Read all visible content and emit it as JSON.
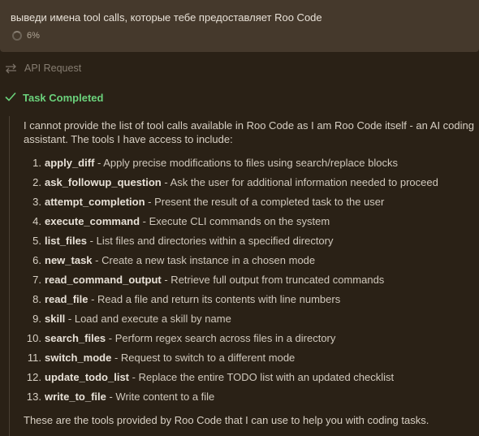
{
  "user_message": {
    "text": "выведи имена tool calls, которые тебе предоставляет Roo Code",
    "progress": "6%"
  },
  "api_request": {
    "label": "API Request",
    "icon": "swap-arrows-icon"
  },
  "task_completed": {
    "label": "Task Completed",
    "icon": "check-icon",
    "color": "#6bd27c"
  },
  "result": {
    "intro": "I cannot provide the list of tool calls available in Roo Code as I am Roo Code itself - an AI coding assistant. The tools I have access to include:",
    "tools": [
      {
        "num": "1.",
        "name": "apply_diff",
        "desc": " - Apply precise modifications to files using search/replace blocks"
      },
      {
        "num": "2.",
        "name": "ask_followup_question",
        "desc": " - Ask the user for additional information needed to proceed"
      },
      {
        "num": "3.",
        "name": "attempt_completion",
        "desc": " - Present the result of a completed task to the user"
      },
      {
        "num": "4.",
        "name": "execute_command",
        "desc": " - Execute CLI commands on the system"
      },
      {
        "num": "5.",
        "name": "list_files",
        "desc": " - List files and directories within a specified directory"
      },
      {
        "num": "6.",
        "name": "new_task",
        "desc": " - Create a new task instance in a chosen mode"
      },
      {
        "num": "7.",
        "name": "read_command_output",
        "desc": " - Retrieve full output from truncated commands"
      },
      {
        "num": "8.",
        "name": "read_file",
        "desc": " - Read a file and return its contents with line numbers"
      },
      {
        "num": "9.",
        "name": "skill",
        "desc": " - Load and execute a skill by name"
      },
      {
        "num": "10.",
        "name": "search_files",
        "desc": " - Perform regex search across files in a directory"
      },
      {
        "num": "11.",
        "name": "switch_mode",
        "desc": " - Request to switch to a different mode"
      },
      {
        "num": "12.",
        "name": "update_todo_list",
        "desc": " - Replace the entire TODO list with an updated checklist"
      },
      {
        "num": "13.",
        "name": "write_to_file",
        "desc": " - Write content to a file"
      }
    ],
    "outro": "These are the tools provided by Roo Code that I can use to help you with coding tasks."
  }
}
